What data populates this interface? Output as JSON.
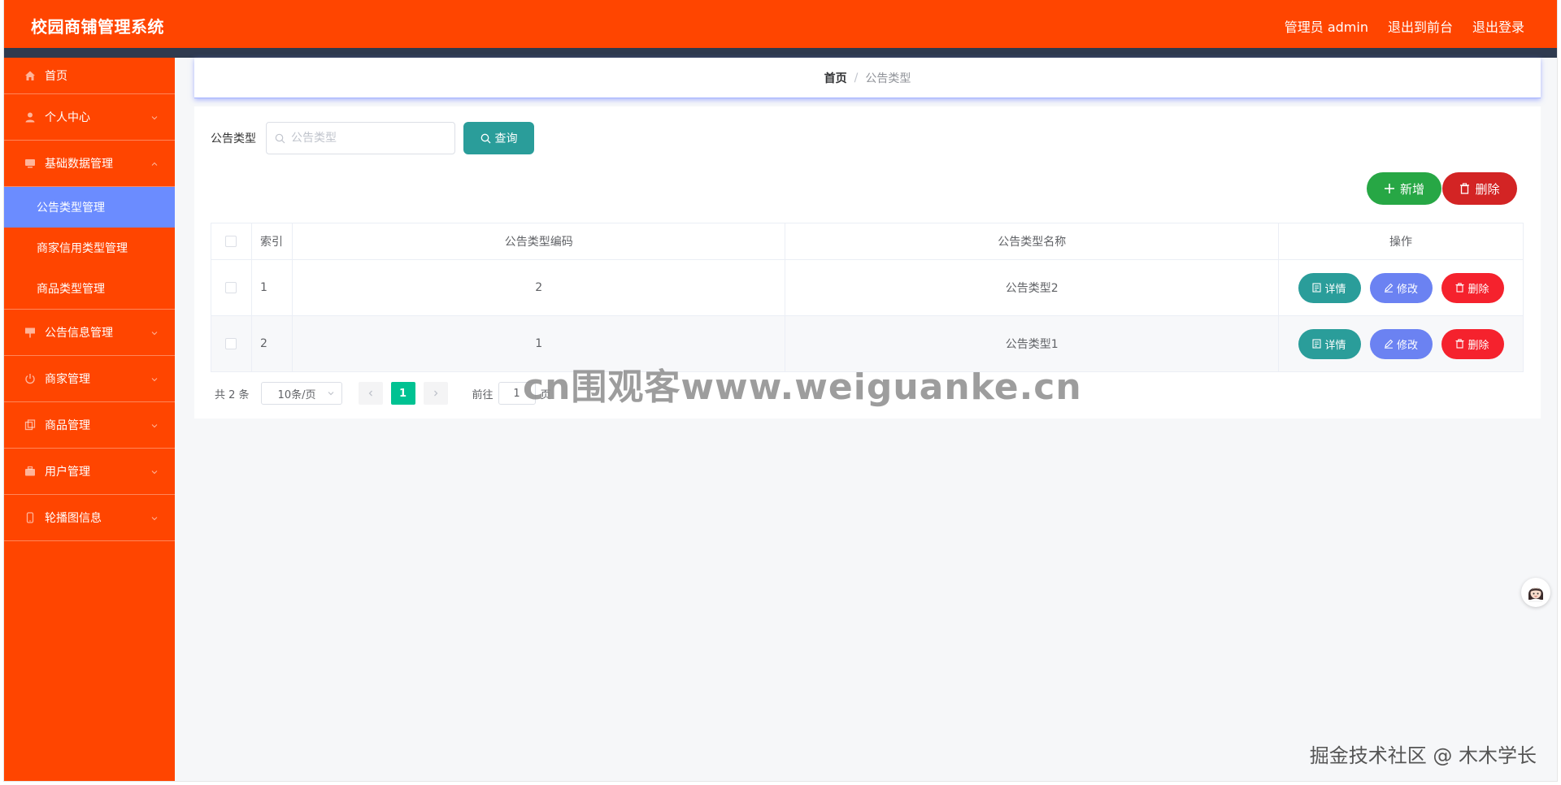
{
  "header": {
    "title": "校园商铺管理系统",
    "user_label": "管理员 admin",
    "front_label": "退出到前台",
    "logout_label": "退出登录"
  },
  "sidebar": {
    "items": [
      {
        "label": "首页",
        "icon": "home-icon"
      },
      {
        "label": "个人中心",
        "icon": "user-icon"
      },
      {
        "label": "基础数据管理",
        "icon": "monitor-icon",
        "expanded": true,
        "children": [
          {
            "label": "公告类型管理",
            "active": true
          },
          {
            "label": "商家信用类型管理"
          },
          {
            "label": "商品类型管理"
          }
        ]
      },
      {
        "label": "公告信息管理",
        "icon": "board-icon"
      },
      {
        "label": "商家管理",
        "icon": "power-icon"
      },
      {
        "label": "商品管理",
        "icon": "copy-icon"
      },
      {
        "label": "用户管理",
        "icon": "briefcase-icon"
      },
      {
        "label": "轮播图信息",
        "icon": "phone-icon"
      }
    ]
  },
  "breadcrumb": {
    "home": "首页",
    "separator": "/",
    "current": "公告类型"
  },
  "search": {
    "label": "公告类型",
    "placeholder": "公告类型",
    "query_label": "查询"
  },
  "actions": {
    "add_label": "新增",
    "delete_label": "删除"
  },
  "table": {
    "headers": [
      "索引",
      "公告类型编码",
      "公告类型名称",
      "操作"
    ],
    "rows": [
      {
        "index": "1",
        "code": "2",
        "name": "公告类型2"
      },
      {
        "index": "2",
        "code": "1",
        "name": "公告类型1"
      }
    ],
    "op_detail": "详情",
    "op_edit": "修改",
    "op_delete": "删除"
  },
  "pagination": {
    "total": "共 2 条",
    "page_size": "10条/页",
    "current_page": "1",
    "goto_prefix": "前往",
    "goto_value": "1",
    "goto_suffix": "页"
  },
  "watermark": {
    "center": "cn围观客www.weiguanke.cn",
    "corner": "掘金技术社区 @ 木木学长"
  },
  "colors": {
    "brand": "#ff4500",
    "header_bar": "#2f3a4f",
    "active_menu": "#6b8cff",
    "query": "#2a9d9a",
    "add": "#27a745",
    "delete": "#d32424",
    "edit": "#6b82f2",
    "page_active": "#00c292"
  }
}
